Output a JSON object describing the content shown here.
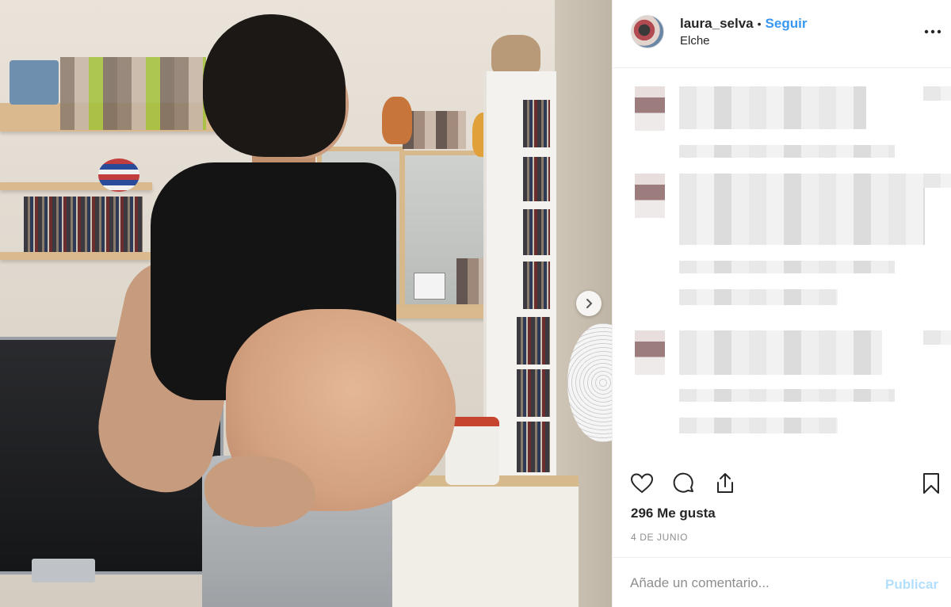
{
  "post": {
    "username": "laura_selva",
    "separator": "•",
    "follow_label": "Seguir",
    "location": "Elche",
    "likes_text": "296 Me gusta",
    "date": "4 DE JUNIO"
  },
  "icons": {
    "more": "more-options-icon",
    "like": "heart-icon",
    "comment": "comment-icon",
    "share": "share-icon",
    "save": "bookmark-icon",
    "next": "chevron-right-icon"
  },
  "comment_form": {
    "placeholder": "Añade un comentario...",
    "publish_label": "Publicar"
  },
  "colors": {
    "link": "#3897f0",
    "publish_disabled": "#b2dffc",
    "muted": "#8e8e8e",
    "text": "#262626"
  }
}
